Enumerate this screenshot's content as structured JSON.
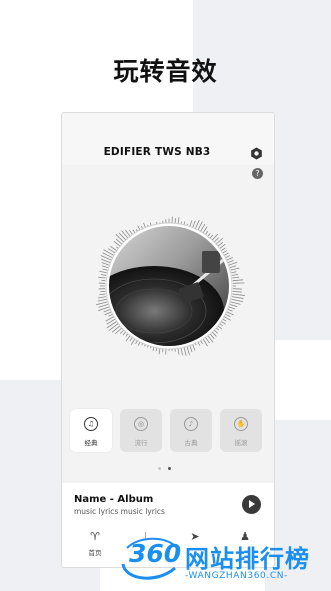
{
  "promo": {
    "title": "玩转音效"
  },
  "header": {
    "device_name": "EDIFIER TWS NB3",
    "help_label": "?"
  },
  "modes": [
    {
      "label": "经典",
      "icon": "music-note-icon",
      "icon_glyph": "♫",
      "active": true
    },
    {
      "label": "流行",
      "icon": "disc-icon",
      "icon_glyph": "◎",
      "active": false
    },
    {
      "label": "古典",
      "icon": "violin-icon",
      "icon_glyph": "♪",
      "active": false
    },
    {
      "label": "摇滚",
      "icon": "hand-icon",
      "icon_glyph": "✋",
      "active": false
    }
  ],
  "pager": {
    "count": 2,
    "active_index": 1
  },
  "now_playing": {
    "title": "Name - Album",
    "subtitle": "music lyrics music lyrics"
  },
  "bottom_nav": [
    {
      "label": "首页",
      "icon": "earbuds-icon",
      "icon_glyph": "♈"
    },
    {
      "label": "",
      "icon": "music-icon",
      "icon_glyph": "♩"
    },
    {
      "label": "",
      "icon": "send-icon",
      "icon_glyph": "➤"
    },
    {
      "label": "",
      "icon": "user-icon",
      "icon_glyph": "♟"
    }
  ],
  "watermark": {
    "logo": "360",
    "name": "网站排行榜",
    "url": "-WANGZHAN360.CN-"
  },
  "colors": {
    "accent": "#1a8ff0",
    "dark": "#3a3a3a",
    "panel": "#f3f3f3"
  }
}
